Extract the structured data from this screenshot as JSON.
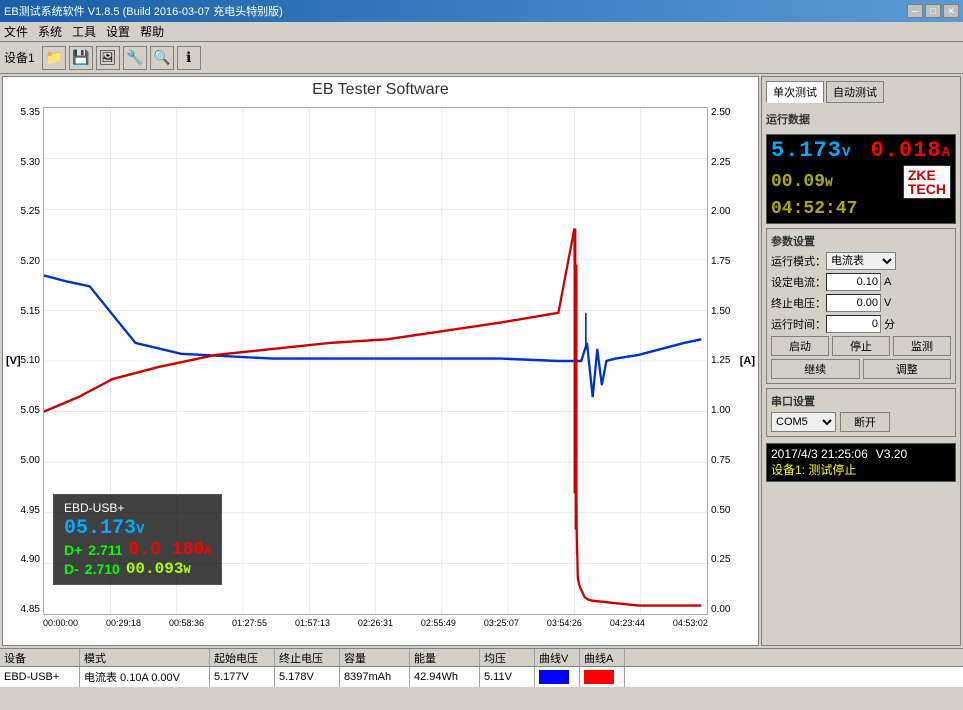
{
  "window": {
    "title": "EB测试系统软件 V1.8.5 (Build 2016-03-07 充电头特别版)",
    "min_btn": "─",
    "max_btn": "□",
    "close_btn": "✕"
  },
  "menu": {
    "items": [
      "文件",
      "系统",
      "工具",
      "设置",
      "帮助"
    ]
  },
  "toolbar": {
    "label": "设备1",
    "icons": [
      "📁",
      "💾",
      "🖼",
      "🔧",
      "🔍",
      "ℹ"
    ]
  },
  "chart": {
    "title": "EB Tester Software",
    "watermark": "ZKETECH",
    "y_left_label": "[V]",
    "y_right_label": "[A]",
    "y_left_values": [
      "5.35",
      "5.30",
      "5.25",
      "5.20",
      "5.15",
      "5.10",
      "5.05",
      "5.00",
      "4.95",
      "4.90",
      "4.85"
    ],
    "y_right_values": [
      "2.50",
      "2.25",
      "2.00",
      "1.75",
      "1.50",
      "1.25",
      "1.00",
      "0.75",
      "0.50",
      "0.25",
      "0.00"
    ],
    "x_values": [
      "00:00:00",
      "00:29:18",
      "00:58:36",
      "01:27:55",
      "01:57:13",
      "02:26:31",
      "02:55:49",
      "03:25:07",
      "03:54:26",
      "04:23:44",
      "04:53:02"
    ]
  },
  "overlay": {
    "device_label": "EBD-USB+",
    "voltage": "05.173",
    "voltage_unit": "V",
    "dp_label": "D+",
    "dp_value": "2.711",
    "current": "0.0 180",
    "current_unit": "A",
    "dm_label": "D-",
    "dm_value": "2.710",
    "power": "00.093",
    "power_unit": "W"
  },
  "right_panel": {
    "tab_single": "单次测试",
    "tab_auto": "自动测试",
    "run_data_label": "运行数据",
    "voltage": "5.173",
    "voltage_unit": "V",
    "current_prefix": "0.0",
    "current_suffix": "18",
    "current_unit": "A",
    "power": "00.09",
    "power_unit": "W",
    "time": "04:52:47",
    "logo_line1": "ZKE",
    "logo_line2": "TECH",
    "params_label": "参数设置",
    "mode_label": "运行模式：",
    "mode_value": "电流表",
    "current_set_label": "设定电流：",
    "current_set_value": "0.10",
    "current_set_unit": "A",
    "end_voltage_label": "终止电压：",
    "end_voltage_value": "0.00",
    "end_voltage_unit": "V",
    "run_time_label": "运行时间：",
    "run_time_value": "0",
    "run_time_unit": "分",
    "btn_start": "启动",
    "btn_stop": "停止",
    "btn_monitor": "监测",
    "btn_continue": "继续",
    "btn_adjust": "调整",
    "serial_label": "串口设置",
    "com_value": "COM5",
    "btn_disconnect": "断开",
    "status_time": "2017/4/3 21:25:06",
    "status_ver": "V3.20",
    "status_msg": "设备1: 测试停止"
  },
  "table": {
    "headers": [
      "设备",
      "模式",
      "起始电压",
      "终止电压",
      "容量",
      "能量",
      "均压",
      "曲线V",
      "曲线A"
    ],
    "rows": [
      {
        "device": "EBD-USB+",
        "mode": "电流表 0.10A 0.00V",
        "start_v": "5.177V",
        "end_v": "5.178V",
        "capacity": "8397mAh",
        "energy": "42.94Wh",
        "avg_v": "5.11V",
        "curve_v_color": "blue",
        "curve_a_color": "red"
      }
    ]
  },
  "colors": {
    "voltage_line": "#0000ff",
    "current_line": "#cc0000",
    "background": "#d4d0c8",
    "accent": "#1a5fa8"
  }
}
